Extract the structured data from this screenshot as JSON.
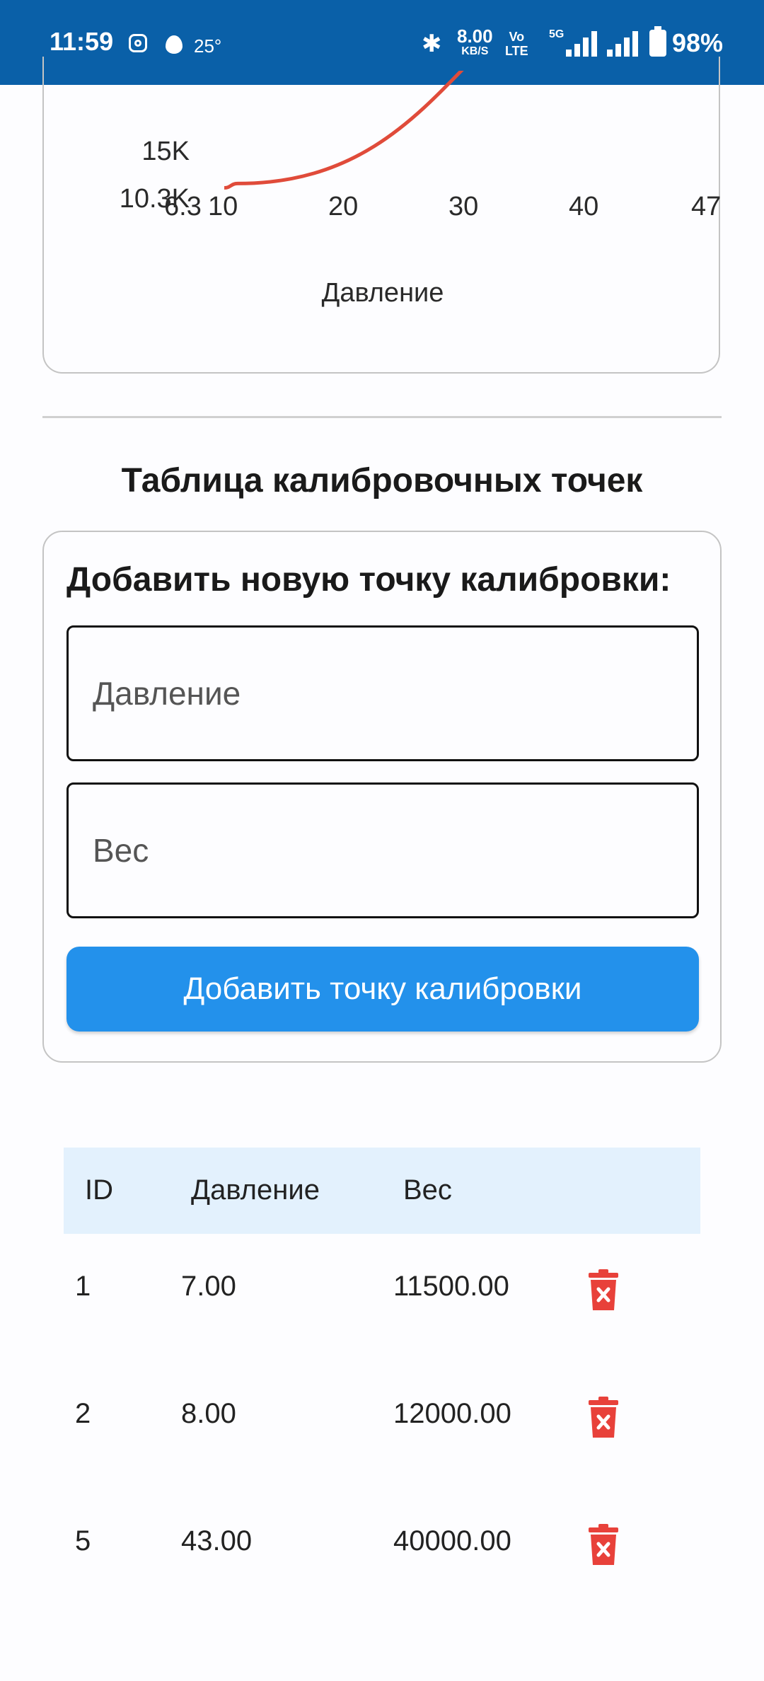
{
  "status_bar": {
    "time": "11:59",
    "temperature": "25°",
    "net_speed": "8.00",
    "net_speed_unit": "KB/S",
    "volte_top": "Vo",
    "volte_bottom": "LTE",
    "network": "5G",
    "battery": "98%"
  },
  "chart_data": {
    "type": "line",
    "xlabel": "Давление",
    "x_ticks": [
      "6.3",
      "10",
      "20",
      "30",
      "40",
      "47.3"
    ],
    "y_ticks_visible": [
      "15K",
      "10.3K"
    ],
    "series": [
      {
        "x": [
          7,
          8,
          43
        ],
        "y": [
          11500,
          12000,
          40000
        ],
        "color": "#e04b3a"
      }
    ]
  },
  "section_title": "Таблица калибровочных точек",
  "form": {
    "heading": "Добавить новую точку калибровки:",
    "pressure_placeholder": "Давление",
    "weight_placeholder": "Вес",
    "add_button": "Добавить точку калибровки"
  },
  "table": {
    "headers": [
      "ID",
      "Давление",
      "Вес"
    ],
    "rows": [
      {
        "id": "1",
        "pressure": "7.00",
        "weight": "11500.00"
      },
      {
        "id": "2",
        "pressure": "8.00",
        "weight": "12000.00"
      },
      {
        "id": "5",
        "pressure": "43.00",
        "weight": "40000.00"
      }
    ],
    "delete_icon": "trash-icon",
    "delete_color": "#e8413a"
  }
}
